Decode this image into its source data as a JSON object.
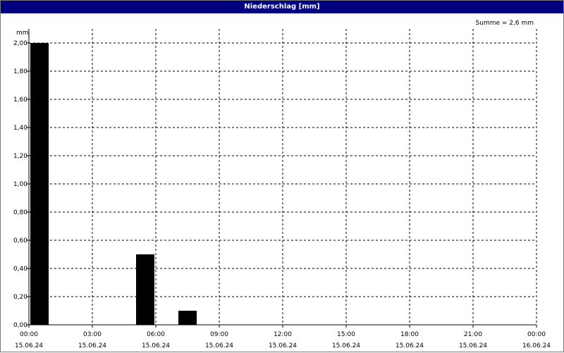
{
  "title": "Niederschlag [mm]",
  "summary": "Summe = 2,6 mm",
  "colors": {
    "titlebar": "#000080",
    "bar": "#000000",
    "grid": "#000000"
  },
  "chart_data": {
    "type": "bar",
    "title": "Niederschlag [mm]",
    "ylabel": "mm",
    "xlabel": "",
    "ylim": [
      0,
      2.0
    ],
    "xlim_hours": [
      0,
      24
    ],
    "grid": true,
    "y_ticks": [
      "0,00",
      "0,20",
      "0,40",
      "0,60",
      "0,80",
      "1,00",
      "1,20",
      "1,40",
      "1,60",
      "1,80",
      "2,00"
    ],
    "x_ticks": [
      {
        "time": "00:00",
        "date": "15.06.24"
      },
      {
        "time": "03:00",
        "date": "15.06.24"
      },
      {
        "time": "06:00",
        "date": "15.06.24"
      },
      {
        "time": "09:00",
        "date": "15.06.24"
      },
      {
        "time": "12:00",
        "date": "15.06.24"
      },
      {
        "time": "15:00",
        "date": "15.06.24"
      },
      {
        "time": "18:00",
        "date": "15.06.24"
      },
      {
        "time": "21:00",
        "date": "15.06.24"
      },
      {
        "time": "00:00",
        "date": "16.06.24"
      }
    ],
    "bars": [
      {
        "start": "15.06.24 00:00",
        "end": "15.06.24 01:00",
        "value": 2.0
      },
      {
        "start": "15.06.24 05:00",
        "end": "15.06.24 06:00",
        "value": 0.5
      },
      {
        "start": "15.06.24 07:00",
        "end": "15.06.24 08:00",
        "value": 0.1
      }
    ]
  }
}
